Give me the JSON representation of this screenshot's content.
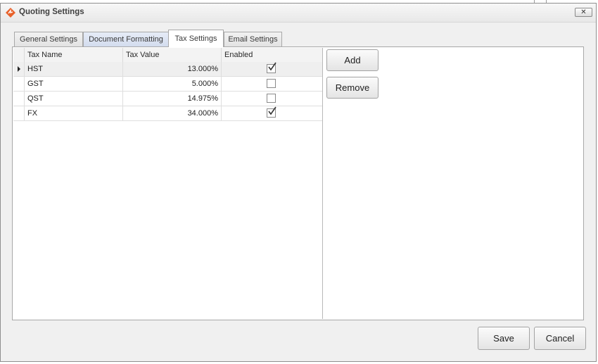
{
  "window": {
    "title": "Quoting Settings",
    "accent": "#e8622c"
  },
  "tabs": [
    {
      "label": "General Settings"
    },
    {
      "label": "Document Formatting"
    },
    {
      "label": "Tax Settings"
    },
    {
      "label": "Email Settings"
    }
  ],
  "active_tab": "Tax Settings",
  "grid": {
    "columns": [
      "Tax Name",
      "Tax Value",
      "Enabled"
    ],
    "rows": [
      {
        "name": "HST",
        "value": "13.000%",
        "enabled": true
      },
      {
        "name": "GST",
        "value": "5.000%",
        "enabled": false
      },
      {
        "name": "QST",
        "value": "14.975%",
        "enabled": false
      },
      {
        "name": "FX",
        "value": "34.000%",
        "enabled": true
      }
    ],
    "selected_row": "HST"
  },
  "side_buttons": {
    "add": "Add",
    "remove": "Remove"
  },
  "footer": {
    "save": "Save",
    "cancel": "Cancel"
  },
  "icons": {
    "app": "app-logo-icon",
    "close": "close-icon",
    "row_indicator": "row-indicator-icon",
    "check": "checkmark-icon"
  }
}
